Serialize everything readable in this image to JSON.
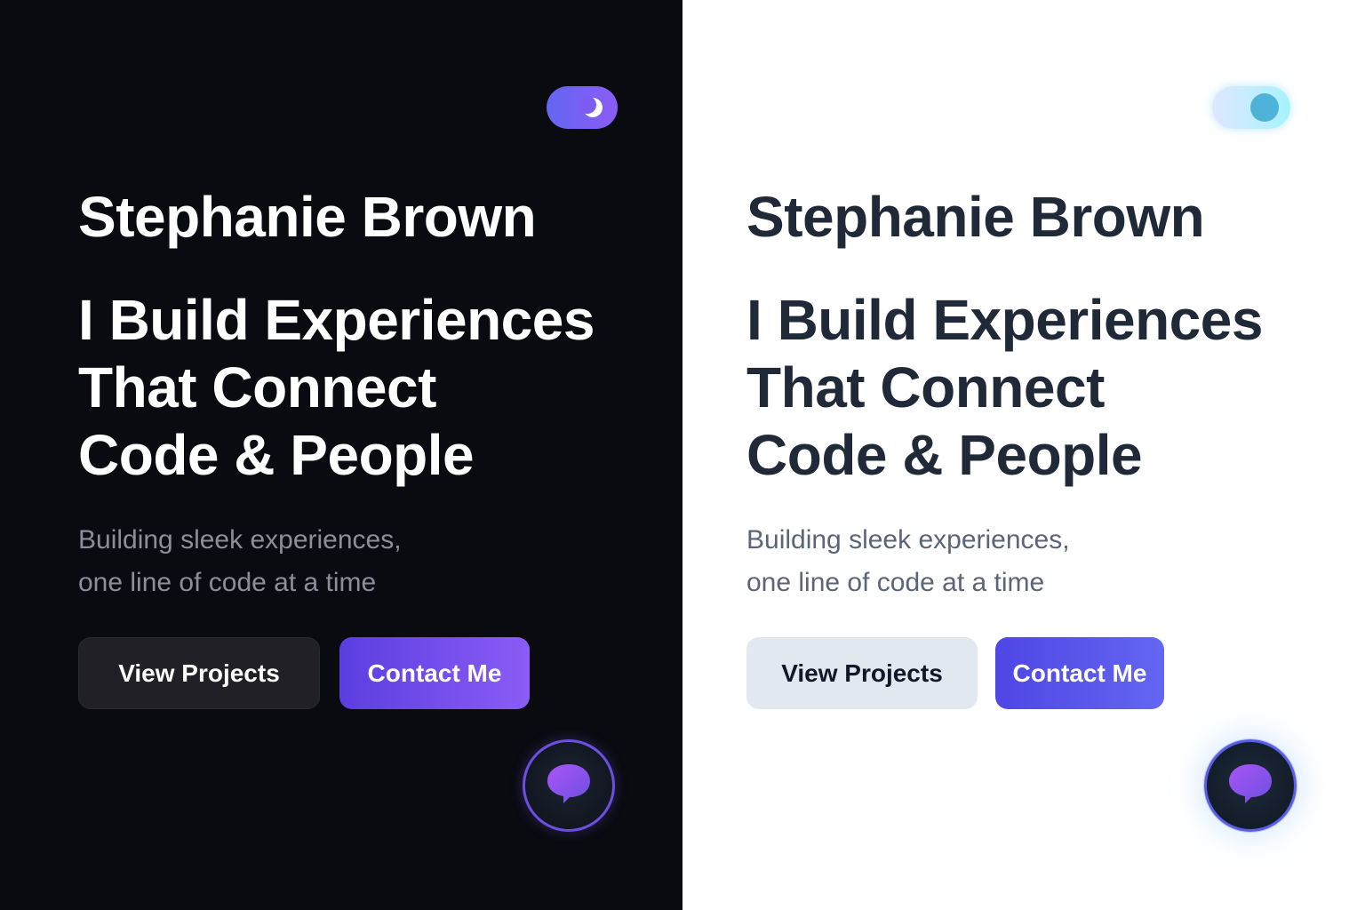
{
  "dark_theme": {
    "name": "Stephanie Brown",
    "headline": [
      "I Build Experiences",
      "That Connect",
      "Code & People"
    ],
    "tagline": [
      "Building sleek experiences,",
      "one line of code at a time"
    ],
    "buttons": {
      "view_projects": "View Projects",
      "contact_me": "Contact Me"
    },
    "toggle_icon": "moon-icon",
    "fab_icon": "chat-bubble-icon",
    "colors": {
      "background": "#0a0b10",
      "accent": "#6366f1",
      "text": "#ffffff"
    }
  },
  "light_theme": {
    "name": "Stephanie Brown",
    "headline": [
      "I Build Experiences",
      "That Connect",
      "Code & People"
    ],
    "tagline": [
      "Building sleek experiences,",
      "one line of code at a time"
    ],
    "buttons": {
      "view_projects": "View Projects",
      "contact_me": "Contact Me"
    },
    "toggle_icon": "sun-knob-icon",
    "fab_icon": "chat-bubble-icon",
    "colors": {
      "background": "#ffffff",
      "accent": "#4f46e5",
      "text": "#1f2937"
    }
  }
}
